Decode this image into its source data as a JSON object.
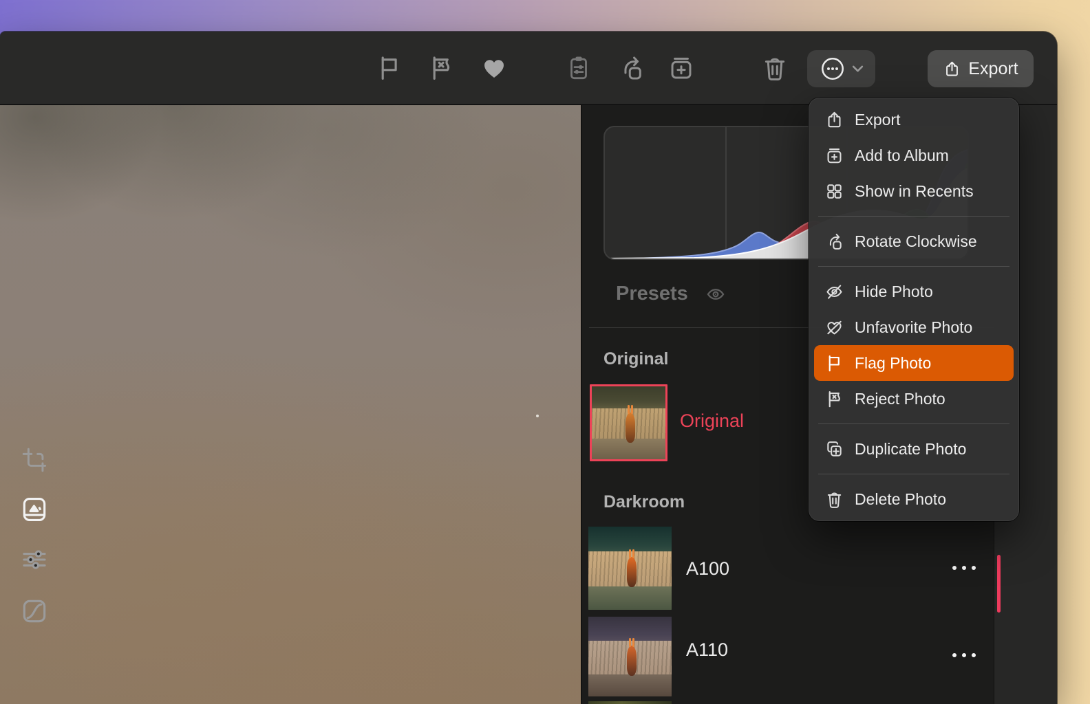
{
  "window": {
    "app": "photo-editor",
    "toolbar": {
      "icons": [
        "flag",
        "reject",
        "favorite",
        "copy-edits",
        "rotate-clockwise",
        "add-to-album",
        "delete"
      ],
      "more_menu": {
        "open": true
      },
      "export_button": {
        "label": "Export"
      }
    },
    "sidebar": {
      "histogram": {
        "type": "area",
        "description": "RGB photo histogram, right-skewed with strong highlight peaks",
        "channels": [
          {
            "name": "blue",
            "color": "#5B79C9",
            "stroke": "#8FA3DD"
          },
          {
            "name": "red",
            "color": "#C8434C",
            "stroke": "#DE7078"
          },
          {
            "name": "green",
            "color": "#3FA33F",
            "stroke": "#6CC96C"
          },
          {
            "name": "luminance",
            "color": "#E3E3E3",
            "stroke": "#FFFFFF"
          }
        ],
        "gridlines": "two vertical thirds"
      },
      "presets_header": {
        "label": "Presets",
        "eye_toggle": true
      },
      "sections": [
        {
          "title": "Original",
          "items": [
            {
              "label": "Original",
              "selected": true,
              "variant": "original"
            }
          ]
        },
        {
          "title": "Darkroom",
          "items": [
            {
              "label": "A100",
              "variant": "a100"
            },
            {
              "label": "A110",
              "variant": "a110"
            }
          ]
        }
      ]
    },
    "right_rail": {
      "icons": [
        "crop",
        "filmstrip",
        "adjustments",
        "curves"
      ],
      "active": "filmstrip"
    }
  },
  "context_menu": {
    "groups": [
      [
        {
          "label": "Export",
          "icon": "share-icon"
        },
        {
          "label": "Add to Album",
          "icon": "album-add-icon"
        },
        {
          "label": "Show in Recents",
          "icon": "grid-icon"
        }
      ],
      [
        {
          "label": "Rotate Clockwise",
          "icon": "rotate-clockwise-icon"
        }
      ],
      [
        {
          "label": "Hide Photo",
          "icon": "eye-slash-icon"
        },
        {
          "label": "Unfavorite Photo",
          "icon": "heart-slash-icon"
        },
        {
          "label": "Flag Photo",
          "icon": "flag-icon",
          "highlighted": true
        },
        {
          "label": "Reject Photo",
          "icon": "flag-x-icon"
        }
      ],
      [
        {
          "label": "Duplicate Photo",
          "icon": "duplicate-icon"
        }
      ],
      [
        {
          "label": "Delete Photo",
          "icon": "trash-icon"
        }
      ]
    ]
  },
  "colors": {
    "accent_pink": "#ED4358",
    "menu_highlight_orange": "#DB5A03",
    "scroll_indicator_red": "#ED3B5D",
    "desktop_gradient_left": "#7E70D0",
    "desktop_gradient_right": "#F2D8A6",
    "window_chrome": "#292928",
    "sidebar_bg": "#1C1C1B"
  }
}
